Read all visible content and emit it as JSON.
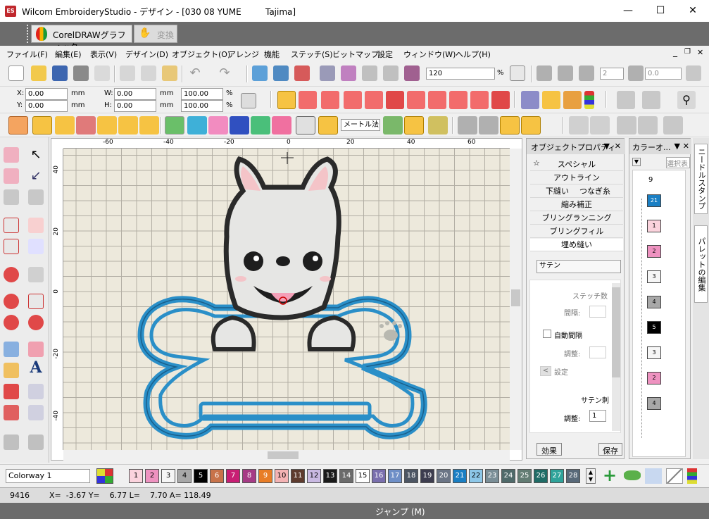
{
  "titlebar": {
    "app": "Wilcom EmbroideryStudio - デザイン - [030 08 YUME         Tajima]",
    "logo": "ES"
  },
  "corel": {
    "button": "CorelDRAWグラフィック",
    "convert": "変換"
  },
  "menu": [
    "ファイル(F)",
    "編集(E)",
    "表示(V)",
    "デザイン(D)",
    "オブジェクト(O)",
    "アレンジ",
    "機能",
    "ステッチ(S)",
    "ビットマップ",
    "設定",
    "ウィンドウ(W)",
    "ヘルプ(H)"
  ],
  "toolbar": {
    "zoom": "120",
    "percent": "%",
    "spin1": "2",
    "spin2": "0.0"
  },
  "coords": {
    "x_label": "X:",
    "y_label": "Y:",
    "w_label": "W:",
    "h_label": "H:",
    "x": "0.00",
    "y": "0.00",
    "w": "0.00",
    "h": "0.00",
    "unit": "mm",
    "sx": "100.00",
    "sy": "100.00",
    "pct": "%"
  },
  "stitchbar": {
    "measure": "メートル法"
  },
  "ruler": {
    "h_ticks": [
      "-60",
      "-40",
      "-20",
      "0",
      "20",
      "40",
      "60"
    ],
    "v_ticks": [
      "40",
      "20",
      "0",
      "-20",
      "-40"
    ]
  },
  "objprop": {
    "title": "オブジェクトプロパティ",
    "special": "スペシャル",
    "outline": "アウトライン",
    "underlay": "下縫い",
    "connect": "つなぎ糸",
    "shrink": "縮み補正",
    "ring_running": "ブリングランニング",
    "ring_fill": "ブリングフィル",
    "fill": "埋め縫い",
    "type": "サテン",
    "stitch_count": "ステッチ数",
    "spacing": "間隔:",
    "auto_spacing": "自動間隔",
    "adjust": "調整:",
    "setting": "設定",
    "satin": "サテン刺",
    "adjust2": "調整:",
    "adjust2_val": "1",
    "effect": "効果",
    "save": "保存"
  },
  "colorpanel": {
    "title": "カラーオ...",
    "select": "選択表",
    "header_num": "9",
    "blocks": [
      {
        "num": "21",
        "color": "#1a7fc4",
        "text_color": "#fff"
      },
      {
        "num": "1",
        "color": "#fbd3dd",
        "text_color": "#000"
      },
      {
        "num": "2",
        "color": "#ee92c0",
        "text_color": "#000"
      },
      {
        "num": "3",
        "color": "#f6f6f6",
        "text_color": "#000"
      },
      {
        "num": "4",
        "color": "#a8a8a8",
        "text_color": "#000"
      },
      {
        "num": "5",
        "color": "#000000",
        "text_color": "#fff"
      },
      {
        "num": "3",
        "color": "#f6f6f6",
        "text_color": "#000"
      },
      {
        "num": "2",
        "color": "#ee92c0",
        "text_color": "#000"
      },
      {
        "num": "4",
        "color": "#a8a8a8",
        "text_color": "#000"
      }
    ]
  },
  "sidetabs": {
    "needle": "ニードルスタンプ",
    "palette": "パレットの編集"
  },
  "colorway": {
    "name": "Colorway 1",
    "swatches": [
      {
        "n": "1",
        "c": "#fbd3dd",
        "t": "#000"
      },
      {
        "n": "2",
        "c": "#ee92c0",
        "t": "#000"
      },
      {
        "n": "3",
        "c": "#f6f6f6",
        "t": "#000"
      },
      {
        "n": "4",
        "c": "#a8a8a8",
        "t": "#000"
      },
      {
        "n": "5",
        "c": "#000000",
        "t": "#fff"
      },
      {
        "n": "6",
        "c": "#c8734a",
        "t": "#fff"
      },
      {
        "n": "7",
        "c": "#c81e74",
        "t": "#fff"
      },
      {
        "n": "8",
        "c": "#a63b86",
        "t": "#fff"
      },
      {
        "n": "9",
        "c": "#e87d27",
        "t": "#fff"
      },
      {
        "n": "10",
        "c": "#f4b3b4",
        "t": "#000"
      },
      {
        "n": "11",
        "c": "#5e3b2e",
        "t": "#fff"
      },
      {
        "n": "12",
        "c": "#c9b9e2",
        "t": "#000"
      },
      {
        "n": "13",
        "c": "#1a1a1a",
        "t": "#fff"
      },
      {
        "n": "14",
        "c": "#6b6b6b",
        "t": "#fff"
      },
      {
        "n": "15",
        "c": "#ffffff",
        "t": "#000"
      },
      {
        "n": "16",
        "c": "#7a6fae",
        "t": "#fff"
      },
      {
        "n": "17",
        "c": "#6e8fc7",
        "t": "#fff"
      },
      {
        "n": "18",
        "c": "#4c5563",
        "t": "#fff"
      },
      {
        "n": "19",
        "c": "#3d3d4f",
        "t": "#fff"
      },
      {
        "n": "20",
        "c": "#6b7586",
        "t": "#fff"
      },
      {
        "n": "21",
        "c": "#1a7fc4",
        "t": "#fff"
      },
      {
        "n": "22",
        "c": "#8dc7e8",
        "t": "#000"
      },
      {
        "n": "23",
        "c": "#7a8e97",
        "t": "#fff"
      },
      {
        "n": "24",
        "c": "#4f6a6a",
        "t": "#fff"
      },
      {
        "n": "25",
        "c": "#627c73",
        "t": "#fff"
      },
      {
        "n": "26",
        "c": "#1f6c66",
        "t": "#fff"
      },
      {
        "n": "27",
        "c": "#2fa39a",
        "t": "#fff"
      },
      {
        "n": "28",
        "c": "#586979",
        "t": "#fff"
      }
    ]
  },
  "status": {
    "stitches": "9416",
    "coords": "X=  -3.67 Y=    6.77 L=    7.70 A= 118.49",
    "jump": "ジャンプ (M)"
  }
}
